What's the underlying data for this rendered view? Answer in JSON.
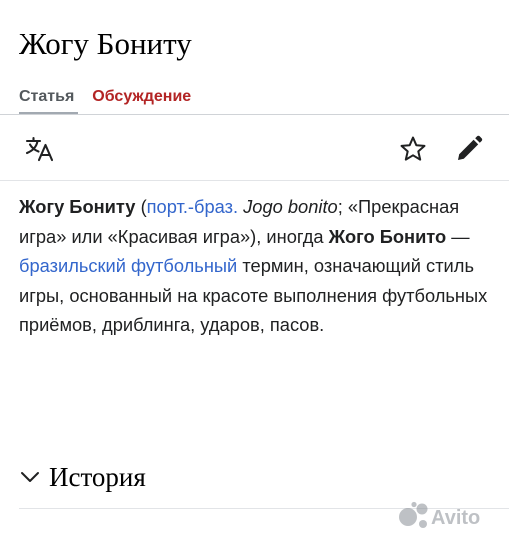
{
  "page": {
    "title": "Жогу Бониту"
  },
  "tabs": [
    {
      "label": "Статья",
      "active": true
    },
    {
      "label": "Обсуждение",
      "active": false
    }
  ],
  "toolbar": {
    "language_icon": "language-icon",
    "watch_icon": "star-icon",
    "edit_icon": "pencil-icon"
  },
  "article": {
    "term": "Жогу Бониту",
    "paren_open": " (",
    "lang_link": "порт.-браз.",
    "space": " ",
    "foreign_term": "Jogo bonito",
    "semicolon": ";",
    "translations": " «Прекрасная игра» или «Красивая игра»), иногда ",
    "alt_term": "Жого Бонито",
    "dash": " — ",
    "link_brazilian": "бразильский",
    "link_football": "футбольный",
    "definition": " термин, означающий стиль игры, основанный на красоте выполнения футбольных приёмов, дриблинга, ударов, пасов."
  },
  "sections": [
    {
      "title": "История",
      "collapsed": true
    }
  ],
  "colors": {
    "link": "#3366cc",
    "talk_tab": "#b32424",
    "text": "#202122",
    "muted": "#54595d"
  },
  "watermark": {
    "label": "Avito"
  }
}
